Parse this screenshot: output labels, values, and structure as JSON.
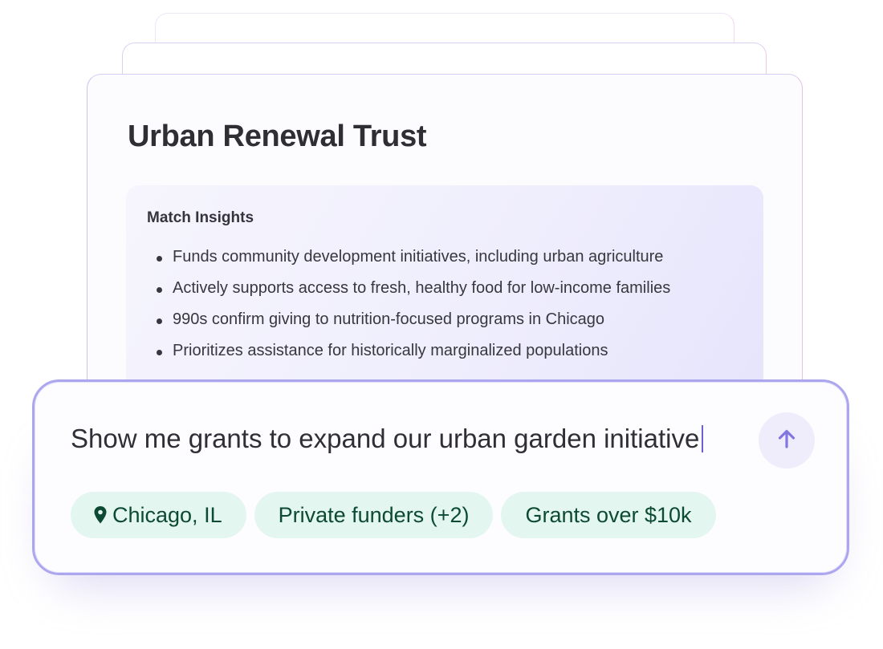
{
  "card": {
    "title": "Urban Renewal Trust",
    "insights": {
      "heading": "Match Insights",
      "items": [
        "Funds community development initiatives, including urban agriculture",
        "Actively supports access to fresh, healthy food for low-income families",
        "990s confirm giving to nutrition-focused programs in Chicago",
        "Prioritizes assistance for historically marginalized populations"
      ]
    }
  },
  "prompt": {
    "text": "Show me grants to expand our urban garden initiative",
    "send_icon": "arrow-up-icon",
    "filters": [
      {
        "label": "Chicago, IL",
        "icon": "location-pin-icon"
      },
      {
        "label": "Private funders (+2)"
      },
      {
        "label": "Grants over $10k"
      }
    ]
  },
  "colors": {
    "accent": "#6b5fd6",
    "prompt_border": "#aca6ee",
    "chip_bg": "#e3f6ef",
    "chip_text": "#0c4a33",
    "insights_bg": "#efeefd"
  }
}
